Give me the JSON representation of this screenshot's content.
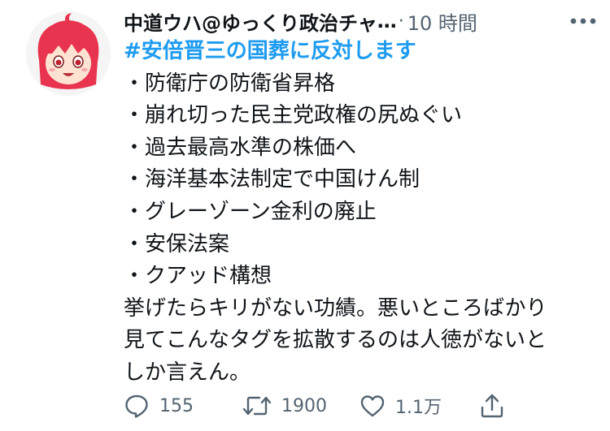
{
  "tweet": {
    "author_name": "中道ウハ@ゆっくり政治チャ",
    "name_truncation": "…",
    "separator": "·",
    "timestamp": "10 時間",
    "hashtag": "#安倍晋三の国葬に反対します",
    "list_items": [
      "・防衛庁の防衛省昇格",
      "・崩れ切った民主党政権の尻ぬぐい",
      "・過去最高水準の株価へ",
      "・海洋基本法制定で中国けん制",
      "・グレーゾーン金利の廃止",
      "・安保法案",
      "・クアッド構想"
    ],
    "closing_lines": [
      "挙げたらキリがない功績。悪いところばかり",
      "見てこんなタグを拡散するのは人徳がないと",
      "しか言えん。"
    ]
  },
  "actions": {
    "reply_count": "155",
    "retweet_count": "1900",
    "like_count": "1.1万"
  },
  "colors": {
    "text": "#0f1419",
    "secondary": "#536471",
    "hashtag": "#1d9bf0",
    "avatar_hair": "#e8344e"
  }
}
